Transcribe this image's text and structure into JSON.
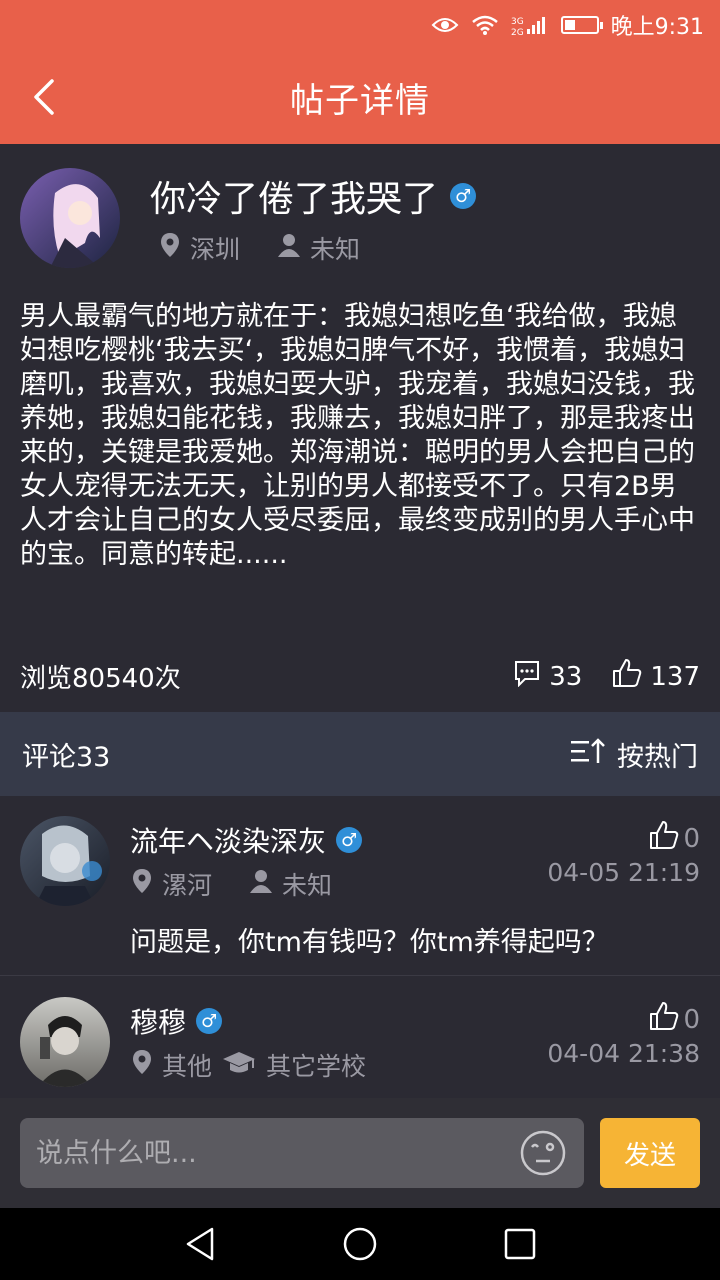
{
  "status_bar": {
    "time": "晚上9:31",
    "network": "3G 2G"
  },
  "header": {
    "title": "帖子详情"
  },
  "post": {
    "author": "你冷了倦了我哭了",
    "gender_symbol": "♂",
    "location": "深圳",
    "identity": "未知",
    "body": "男人最霸气的地方就在于：我媳妇想吃鱼‘我给做，我媳妇想吃樱桃‘我去买‘，我媳妇脾气不好，我惯着，我媳妇磨叽，我喜欢，我媳妇耍大驴，我宠着，我媳妇没钱，我养她，我媳妇能花钱，我赚去，我媳妇胖了，那是我疼出来的，关键是我爱她。郑海潮说：聪明的男人会把自己的女人宠得无法无天，让别的男人都接受不了。只有2B男人才会让自己的女人受尽委屈，最终变成别的男人手心中的宝。同意的转起......",
    "views": "浏览80540次",
    "comment_count": "33",
    "like_count": "137"
  },
  "comments_bar": {
    "title": "评论33",
    "sort_label": "按热门"
  },
  "comments": [
    {
      "name": "流年ヘ淡染深灰",
      "gender_symbol": "♂",
      "location": "漯河",
      "identity": "未知",
      "likes": "0",
      "time": "04-05 21:19",
      "text": "问题是，你tm有钱吗？你tm养得起吗？"
    },
    {
      "name": "穆穆",
      "gender_symbol": "♂",
      "location": "其他",
      "identity": "其它学校",
      "likes": "0",
      "time": "04-04 21:38",
      "text": ""
    }
  ],
  "input_bar": {
    "placeholder": "说点什么吧...",
    "send_label": "发送"
  },
  "colors": {
    "accent": "#e8604a",
    "send_button": "#f6b435",
    "male_badge": "#2f8fd8",
    "background": "#2b2a33"
  },
  "icons": [
    "eye-icon",
    "wifi-icon",
    "signal-icon",
    "battery-icon",
    "back-icon",
    "location-icon",
    "person-icon",
    "school-icon",
    "comment-icon",
    "thumb-up-icon",
    "sort-icon",
    "emoji-icon",
    "nav-back-icon",
    "nav-home-icon",
    "nav-recent-icon"
  ]
}
